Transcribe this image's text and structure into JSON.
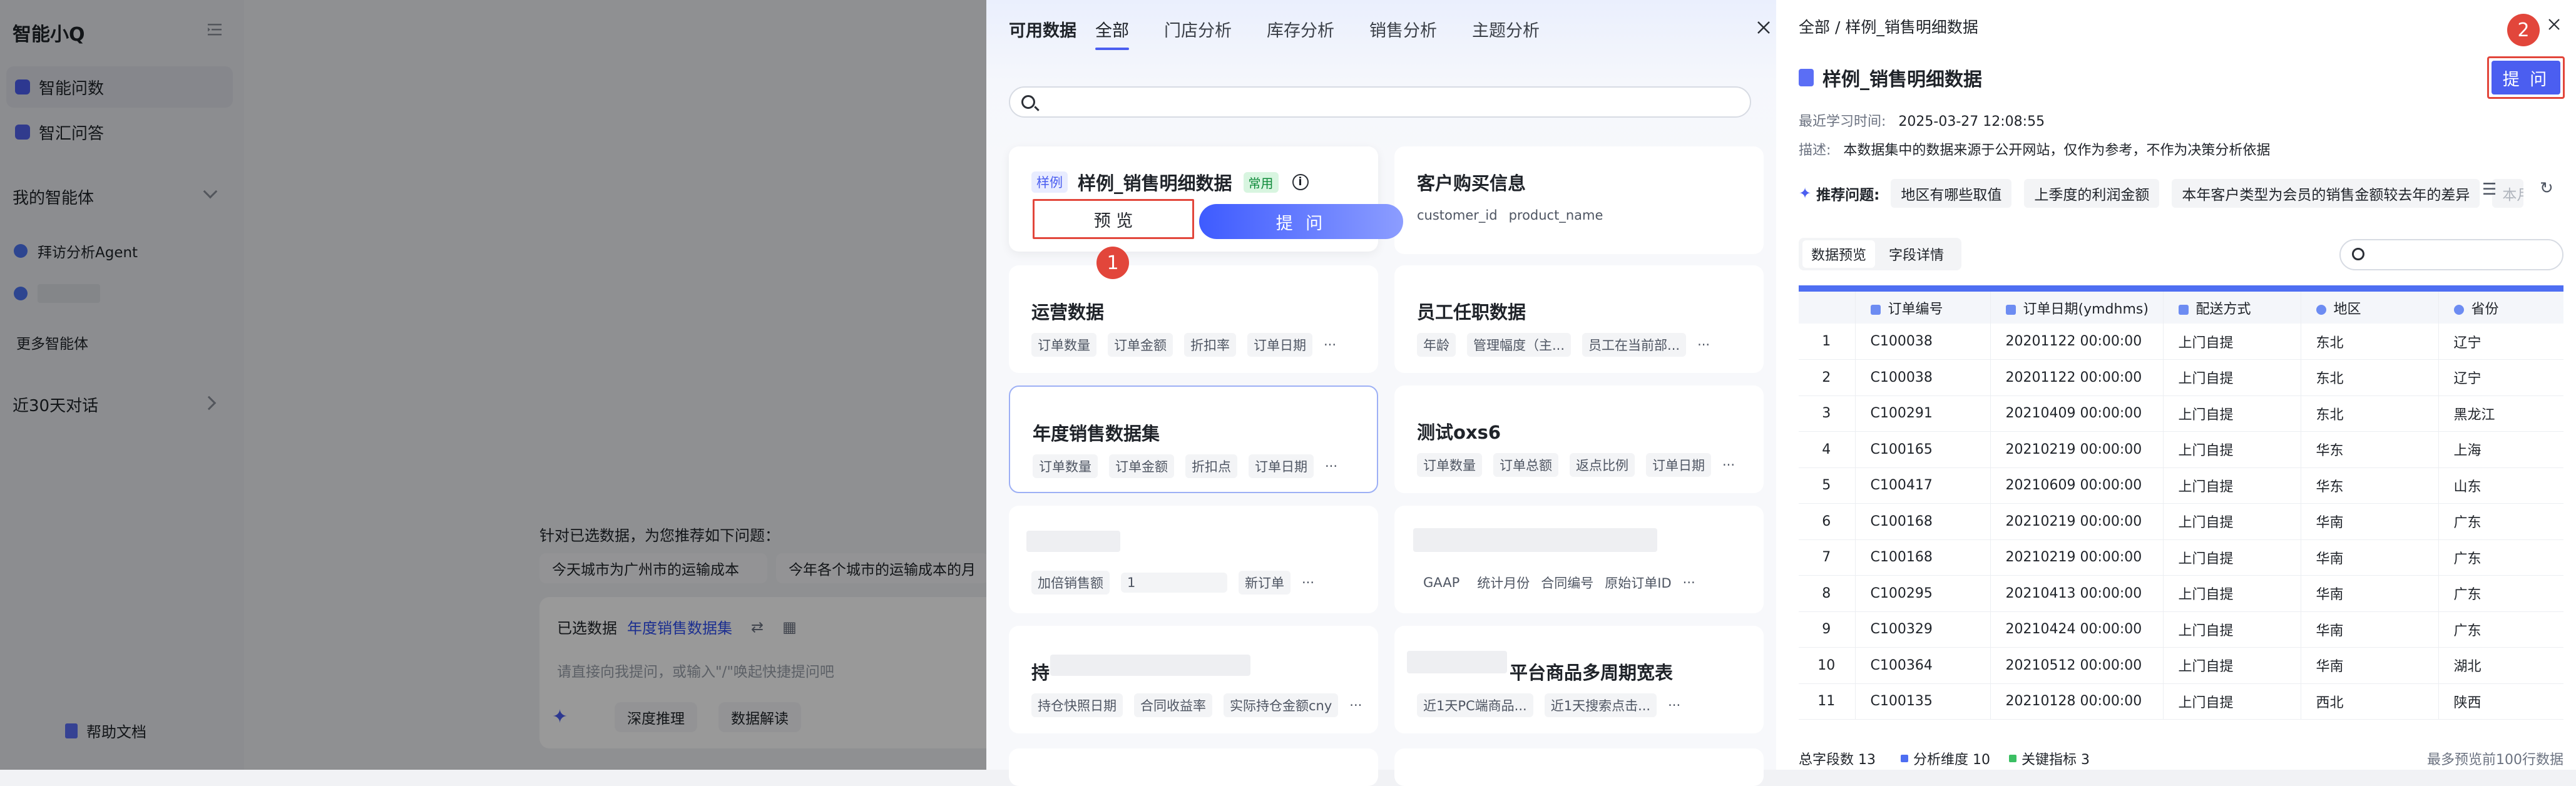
{
  "sidebar": {
    "brand": "智能小Q",
    "nav": [
      {
        "label": "智能问数",
        "active": true
      },
      {
        "label": "智汇问答",
        "active": false
      }
    ],
    "agents_section": "我的智能体",
    "agents": [
      {
        "label": "拜访分析Agent"
      }
    ],
    "more_agents": "更多智能体",
    "history_section": "近30天对话",
    "help": "帮助文档"
  },
  "chat": {
    "suggest_title": "针对已选数据，为您推荐如下问题：",
    "chips": [
      "今天城市为广州市的运输成本",
      "今年各个城市的运输成本的月"
    ],
    "input": {
      "selected_label": "已选数据",
      "selected_value": "年度销售数据集",
      "placeholder": "请直接向我提问，或输入\"/\"唤起快捷提问吧",
      "actions": [
        "深度推理",
        "数据解读"
      ]
    }
  },
  "datasets": {
    "lead": "可用数据",
    "tabs": [
      "全部",
      "门店分析",
      "库存分析",
      "销售分析",
      "主题分析"
    ],
    "cards": [
      {
        "title": "样例_销售明细数据",
        "sample_tag": "样例",
        "common_tag": "常用",
        "preview": "预 览",
        "ask": "提 问"
      },
      {
        "title": "客户购买信息",
        "tags": [
          "customer_id",
          "product_name"
        ]
      },
      {
        "title": "运营数据",
        "tags": [
          "订单数量",
          "订单金额",
          "折扣率",
          "订单日期",
          "···"
        ]
      },
      {
        "title": "员工任职数据",
        "tags": [
          "年龄",
          "管理幅度（主...",
          "员工在当前部...",
          "···"
        ]
      },
      {
        "title": "年度销售数据集",
        "tags": [
          "订单数量",
          "订单金额",
          "折扣点",
          "订单日期",
          "···"
        ]
      },
      {
        "title": "测试oxs6",
        "tags": [
          "订单数量",
          "订单总额",
          "返点比例",
          "订单日期",
          "···"
        ]
      },
      {
        "title": "",
        "tags": [
          "加倍销售额",
          "1",
          "新订单",
          "···"
        ]
      },
      {
        "title": "",
        "tags": [
          "GAAP",
          "统计月份",
          "合同编号",
          "原始订单ID",
          "···"
        ]
      },
      {
        "title": "持",
        "tags": [
          "持仓快照日期",
          "合同收益率",
          "实际持仓金额cny",
          "···"
        ]
      },
      {
        "title": "平台商品多周期宽表",
        "tags": [
          "近1天PC端商品...",
          "近1天搜索点击...",
          "···"
        ]
      }
    ],
    "step_badge": "1"
  },
  "detail": {
    "breadcrumb": "全部 / 样例_销售明细数据",
    "title": "样例_销售明细数据",
    "ask": "提 问",
    "step_badge": "2",
    "learn_label": "最近学习时间:",
    "learn_value": "2025-03-27 12:08:55",
    "desc_label": "描述:",
    "desc_value": "本数据集中的数据来源于公开网站，仅作为参考，不作为决策分析依据",
    "rec_label": "推荐问题:",
    "rec_questions": [
      "地区有哪些取值",
      "上季度的利润金额",
      "本年客户类型为会员的销售金额较去年的差异",
      "本月"
    ],
    "data_tabs": [
      "数据预览",
      "字段详情"
    ],
    "columns": [
      "",
      "订单编号",
      "订单日期(ymdhms)",
      "配送方式",
      "地区",
      "省份"
    ],
    "rows": [
      [
        "1",
        "C100038",
        "20201122 00:00:00",
        "上门自提",
        "东北",
        "辽宁"
      ],
      [
        "2",
        "C100038",
        "20201122 00:00:00",
        "上门自提",
        "东北",
        "辽宁"
      ],
      [
        "3",
        "C100291",
        "20210409 00:00:00",
        "上门自提",
        "东北",
        "黑龙江"
      ],
      [
        "4",
        "C100165",
        "20210219 00:00:00",
        "上门自提",
        "华东",
        "上海"
      ],
      [
        "5",
        "C100417",
        "20210609 00:00:00",
        "上门自提",
        "华东",
        "山东"
      ],
      [
        "6",
        "C100168",
        "20210219 00:00:00",
        "上门自提",
        "华南",
        "广东"
      ],
      [
        "7",
        "C100168",
        "20210219 00:00:00",
        "上门自提",
        "华南",
        "广东"
      ],
      [
        "8",
        "C100295",
        "20210413 00:00:00",
        "上门自提",
        "华南",
        "广东"
      ],
      [
        "9",
        "C100329",
        "20210424 00:00:00",
        "上门自提",
        "华南",
        "广东"
      ],
      [
        "10",
        "C100364",
        "20210512 00:00:00",
        "上门自提",
        "华南",
        "湖北"
      ],
      [
        "11",
        "C100135",
        "20210128 00:00:00",
        "上门自提",
        "西北",
        "陕西"
      ]
    ],
    "footer": {
      "total": "总字段数 13",
      "dims": "分析维度 10",
      "metrics": "关键指标 3",
      "note": "最多预览前100行数据"
    }
  },
  "colors": {
    "accent": "#4b5ef0",
    "highlight": "#e2463b",
    "dim_color": "#4e6ef2",
    "metric_color": "#3bbf63"
  }
}
